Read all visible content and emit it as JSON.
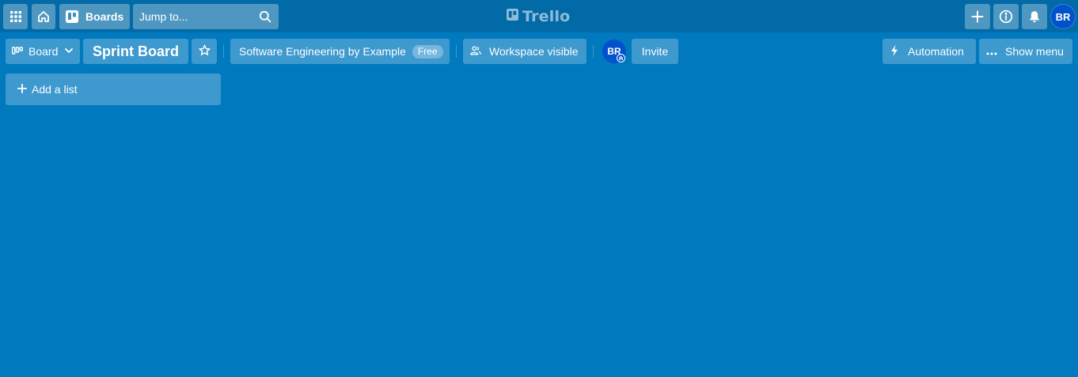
{
  "header": {
    "boards_label": "Boards",
    "search": {
      "placeholder": "Jump to...",
      "value": ""
    },
    "logo_text": "Trello",
    "user_initials": "BR",
    "icons": [
      "apps-icon",
      "home-icon",
      "boards-icon",
      "search-icon",
      "plus-icon",
      "info-icon",
      "bell-icon"
    ]
  },
  "board": {
    "view_label": "Board",
    "title": "Sprint Board",
    "org_name": "Software Engineering by Example",
    "org_badge": "Free",
    "visibility_label": "Workspace visible",
    "member_initials": "BR",
    "invite_label": "Invite",
    "automation_label": "Automation",
    "menu_label": "Show menu"
  },
  "canvas": {
    "add_list_label": "Add a list"
  },
  "colors": {
    "board_background": "#0079bf",
    "header_background": "#026aa7",
    "avatar": "#0052cc"
  }
}
